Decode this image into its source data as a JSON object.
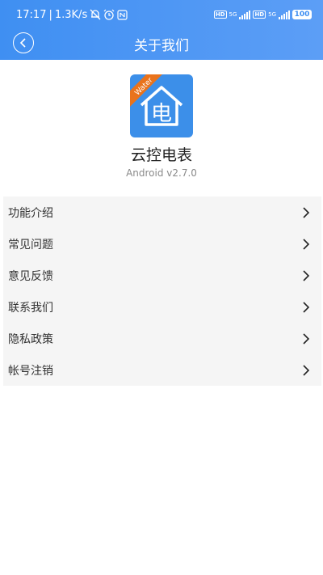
{
  "status_bar": {
    "time": "17:17",
    "speed": "1.3K/s",
    "hd": "HD",
    "net": "5G",
    "battery": "100"
  },
  "navbar": {
    "title": "关于我们"
  },
  "app": {
    "badge": "Water",
    "glyph": "电",
    "name": "云控电表",
    "version": "Android v2.7.0"
  },
  "menu": {
    "items": [
      {
        "label": "功能介绍"
      },
      {
        "label": "常见问题"
      },
      {
        "label": "意见反馈"
      },
      {
        "label": "联系我们"
      },
      {
        "label": "隐私政策"
      },
      {
        "label": "帐号注销"
      }
    ]
  },
  "colors": {
    "header_start": "#3f8ff2",
    "header_end": "#5c9ef6",
    "icon_bg": "#3c8fe9",
    "ribbon": "#e9731c",
    "menu_bg": "#f5f5f5"
  }
}
